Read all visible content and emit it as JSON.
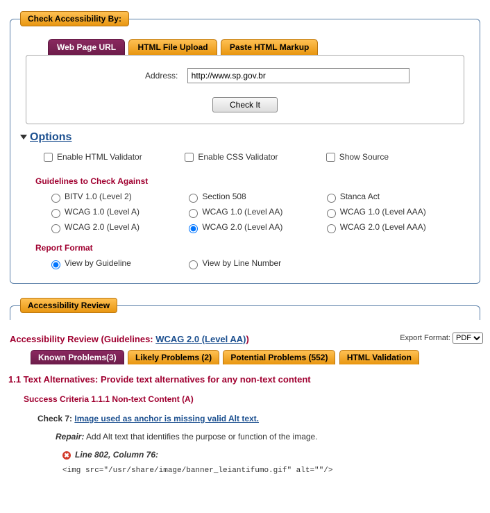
{
  "check_panel": {
    "legend": "Check Accessibility By:",
    "tabs": [
      {
        "label": "Web Page URL",
        "active": true
      },
      {
        "label": "HTML File Upload",
        "active": false
      },
      {
        "label": "Paste HTML Markup",
        "active": false
      }
    ],
    "address_label": "Address:",
    "address_value": "http://www.sp.gov.br",
    "check_button": "Check It"
  },
  "options": {
    "heading": "Options",
    "validators": [
      {
        "label": "Enable HTML Validator",
        "checked": false
      },
      {
        "label": "Enable CSS Validator",
        "checked": false
      },
      {
        "label": "Show Source",
        "checked": false
      }
    ],
    "guidelines_heading": "Guidelines to Check Against",
    "guidelines": [
      [
        {
          "label": "BITV 1.0 (Level 2)",
          "checked": false
        },
        {
          "label": "Section 508",
          "checked": false
        },
        {
          "label": "Stanca Act",
          "checked": false
        }
      ],
      [
        {
          "label": "WCAG 1.0 (Level A)",
          "checked": false
        },
        {
          "label": "WCAG 1.0 (Level AA)",
          "checked": false
        },
        {
          "label": "WCAG 1.0 (Level AAA)",
          "checked": false
        }
      ],
      [
        {
          "label": "WCAG 2.0 (Level A)",
          "checked": false
        },
        {
          "label": "WCAG 2.0 (Level AA)",
          "checked": true
        },
        {
          "label": "WCAG 2.0 (Level AAA)",
          "checked": false
        }
      ]
    ],
    "report_heading": "Report Format",
    "report": [
      {
        "label": "View by Guideline",
        "checked": true
      },
      {
        "label": "View by Line Number",
        "checked": false
      }
    ]
  },
  "review": {
    "legend": "Accessibility Review",
    "title_prefix": "Accessibility Review (Guidelines: ",
    "guideline_link": "WCAG 2.0 (Level AA)",
    "title_suffix": ")",
    "export_label": "Export Format:",
    "export_option": "PDF",
    "tabs": [
      {
        "label": "Known Problems(3)",
        "active": true
      },
      {
        "label": "Likely Problems (2)",
        "active": false
      },
      {
        "label": "Potential Problems (552)",
        "active": false
      },
      {
        "label": "HTML Validation",
        "active": false
      }
    ],
    "guideline_h": "1.1 Text Alternatives: Provide text alternatives for any non-text content",
    "criteria_h": "Success Criteria 1.1.1 Non-text Content (A)",
    "check_label": "Check 7: ",
    "check_link": "Image used as anchor is missing valid Alt text.",
    "repair_label": "Repair:",
    "repair_text": " Add Alt text that identifies the purpose or function of the image.",
    "error_ref": "Line 802, Column 76",
    "error_colon": ":",
    "code": "<img src=\"/usr/share/image/banner_leiantifumo.gif\" alt=\"\"/>"
  }
}
